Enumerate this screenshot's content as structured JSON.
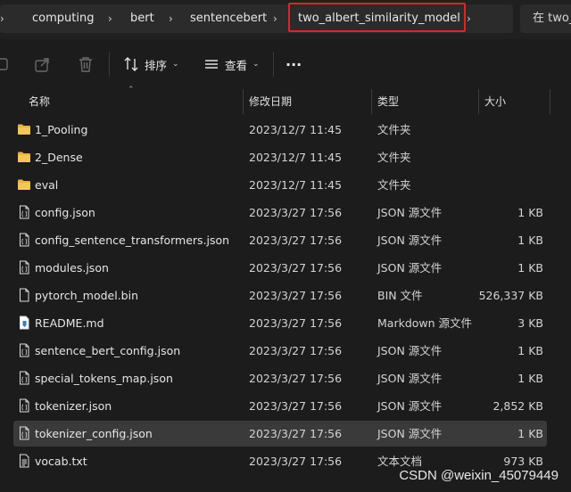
{
  "breadcrumb": {
    "items": [
      "computing",
      "bert",
      "sentencebert",
      "two_albert_similarity_model"
    ],
    "search_placeholder": "在 two_"
  },
  "toolbar": {
    "sort_label": "排序",
    "view_label": "查看",
    "more_label": "···"
  },
  "columns": {
    "name": "名称",
    "date": "修改日期",
    "type": "类型",
    "size": "大小"
  },
  "files": [
    {
      "name": "1_Pooling",
      "date": "2023/12/7 11:45",
      "type": "文件夹",
      "size": "",
      "icon": "folder-icon"
    },
    {
      "name": "2_Dense",
      "date": "2023/12/7 11:45",
      "type": "文件夹",
      "size": "",
      "icon": "folder-icon"
    },
    {
      "name": "eval",
      "date": "2023/12/7 11:45",
      "type": "文件夹",
      "size": "",
      "icon": "folder-icon"
    },
    {
      "name": "config.json",
      "date": "2023/3/27 17:56",
      "type": "JSON 源文件",
      "size": "1 KB",
      "icon": "json-file-icon"
    },
    {
      "name": "config_sentence_transformers.json",
      "date": "2023/3/27 17:56",
      "type": "JSON 源文件",
      "size": "1 KB",
      "icon": "json-file-icon"
    },
    {
      "name": "modules.json",
      "date": "2023/3/27 17:56",
      "type": "JSON 源文件",
      "size": "1 KB",
      "icon": "json-file-icon"
    },
    {
      "name": "pytorch_model.bin",
      "date": "2023/3/27 17:56",
      "type": "BIN 文件",
      "size": "526,337 KB",
      "icon": "file-icon"
    },
    {
      "name": "README.md",
      "date": "2023/3/27 17:56",
      "type": "Markdown 源文件",
      "size": "3 KB",
      "icon": "markdown-file-icon"
    },
    {
      "name": "sentence_bert_config.json",
      "date": "2023/3/27 17:56",
      "type": "JSON 源文件",
      "size": "1 KB",
      "icon": "json-file-icon"
    },
    {
      "name": "special_tokens_map.json",
      "date": "2023/3/27 17:56",
      "type": "JSON 源文件",
      "size": "1 KB",
      "icon": "json-file-icon"
    },
    {
      "name": "tokenizer.json",
      "date": "2023/3/27 17:56",
      "type": "JSON 源文件",
      "size": "2,852 KB",
      "icon": "json-file-icon"
    },
    {
      "name": "tokenizer_config.json",
      "date": "2023/3/27 17:56",
      "type": "JSON 源文件",
      "size": "1 KB",
      "icon": "json-file-icon",
      "selected": true
    },
    {
      "name": "vocab.txt",
      "date": "2023/3/27 17:56",
      "type": "文本文档",
      "size": "973 KB",
      "icon": "text-file-icon"
    }
  ],
  "colors": {
    "folder": "#e8b341",
    "highlight": "#e02424",
    "selected_row": "#3a3a3a"
  },
  "watermark": "CSDN @weixin_45079449"
}
